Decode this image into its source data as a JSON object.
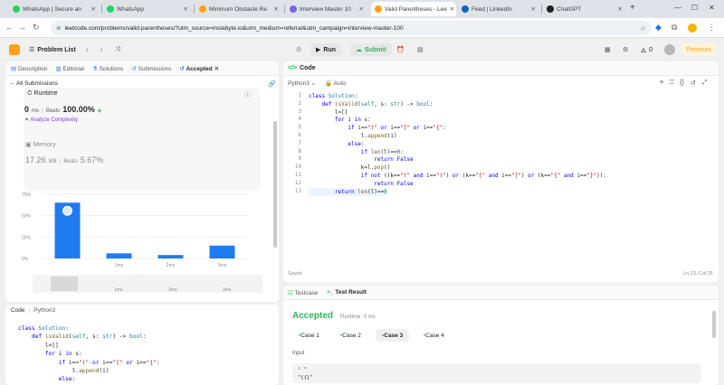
{
  "browser": {
    "tabs": [
      {
        "title": "WhatsApp | Secure an",
        "icon": "whatsapp-icon",
        "color": "#25d366"
      },
      {
        "title": "WhatsApp",
        "icon": "whatsapp-icon",
        "color": "#25d366"
      },
      {
        "title": "Minimum Obstacle Re",
        "icon": "leetcode-icon",
        "color": "#ffa116"
      },
      {
        "title": "Interview Master 10",
        "icon": "interview-master-icon",
        "color": "#7b61ff"
      },
      {
        "title": "Valid Parentheses - Lee",
        "icon": "leetcode-icon",
        "color": "#ffa116"
      },
      {
        "title": "Feed | LinkedIn",
        "icon": "linkedin-icon",
        "color": "#0a66c2"
      },
      {
        "title": "ChatGPT",
        "icon": "chatgpt-icon",
        "color": "#202123"
      }
    ],
    "url": "leetcode.com/problems/valid-parentheses/?utm_source=instabyte.io&utm_medium=referral&utm_campaign=interview-master-100"
  },
  "topbar": {
    "problem_list": "Problem List",
    "run": "Run",
    "submit": "Submit",
    "streak": "0",
    "premium": "Premium"
  },
  "left": {
    "tabs": [
      "Description",
      "Editorial",
      "Solutions",
      "Submissions",
      "Accepted"
    ],
    "all_submissions": "All Submissions",
    "runtime": {
      "label": "Runtime",
      "value": "0",
      "unit": "ms",
      "beats_label": "Beats",
      "beats_value": "100.00%",
      "analyze": "Analyze Complexity"
    },
    "memory": {
      "label": "Memory",
      "value": "17.26",
      "unit": "MB",
      "beats_label": "Beats",
      "beats_value": "5.67%"
    },
    "code_tab": "Code",
    "code_lang": "Python3",
    "code_lines": [
      "class Solution:",
      "    def isValid(self, s: str) -> bool:",
      "        l=[]",
      "        for i in s:",
      "            if i==\"(\" or i==\"[\" or i==\"{\":",
      "                l.append(i)",
      "            else:"
    ]
  },
  "chart_data": {
    "type": "bar",
    "categories": [
      "",
      "1ms",
      "2ms",
      "3ms"
    ],
    "values": [
      65,
      6,
      4,
      15
    ],
    "yticks": [
      "75%",
      "50%",
      "25%",
      "0%"
    ],
    "ylim": [
      0,
      80
    ],
    "highlight_index": 0,
    "bar_color": "#1f7cf0",
    "grid": true,
    "overview_labels": [
      "1ms",
      "2ms",
      "3ms"
    ]
  },
  "editor": {
    "title": "Code",
    "language": "Python3",
    "auto": "Auto",
    "lines": [
      "class Solution:",
      "    def isValid(self, s: str) -> bool:",
      "        l=[]",
      "        for i in s:",
      "            if i==\"(\" or i==\"[\" or i==\"{\":",
      "                l.append(i)",
      "            else:",
      "                if len(l)==0:",
      "                    return False",
      "                k=l.pop()",
      "                if not ((k==\"(\" and i==\")\") or (k==\"[\" and i==\"]\") or (k==\"{\" and i==\"}\")):",
      "                    return False",
      "        return len(l)==0"
    ],
    "status": "Saved",
    "cursor": "Ln 13, Col 25"
  },
  "testresult": {
    "tab_testcase": "Testcase",
    "tab_result": "Test Result",
    "verdict": "Accepted",
    "runtime": "Runtime: 0 ms",
    "cases": [
      "Case 1",
      "Case 2",
      "Case 3",
      "Case 4"
    ],
    "active_case": 2,
    "input_label": "Input",
    "input_var": "s =",
    "input_value": "\"{{}\""
  }
}
